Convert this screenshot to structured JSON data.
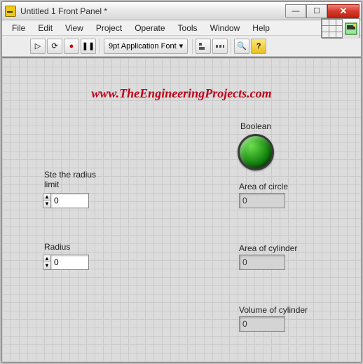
{
  "titlebar": {
    "text": "Untitled 1 Front Panel *",
    "min": "—",
    "max": "☐",
    "close": "✕"
  },
  "menu": {
    "file": "File",
    "edit": "Edit",
    "view": "View",
    "project": "Project",
    "operate": "Operate",
    "tools": "Tools",
    "window": "Window",
    "help": "Help"
  },
  "toolbar": {
    "run": "▷",
    "run_cont": "⟳",
    "abort": "●",
    "pause": "❚❚",
    "font": "9pt Application Font",
    "font_caret": "▾",
    "align": "▾",
    "dist": "▾",
    "search": "🔍",
    "help": "?"
  },
  "watermark": "www.TheEngineeringProjects.com",
  "controls": {
    "radius_limit": {
      "label": "Ste the radius\nlimit",
      "value": "0"
    },
    "radius": {
      "label": "Radius",
      "value": "0"
    },
    "boolean": {
      "label": "Boolean"
    },
    "area_circle": {
      "label": "Area of circle",
      "value": "0"
    },
    "area_cylinder": {
      "label": "Area of cylinder",
      "value": "0"
    },
    "volume_cylinder": {
      "label": "Volume of cylinder",
      "value": "0"
    }
  },
  "spin": {
    "up": "▲",
    "dn": "▼"
  }
}
